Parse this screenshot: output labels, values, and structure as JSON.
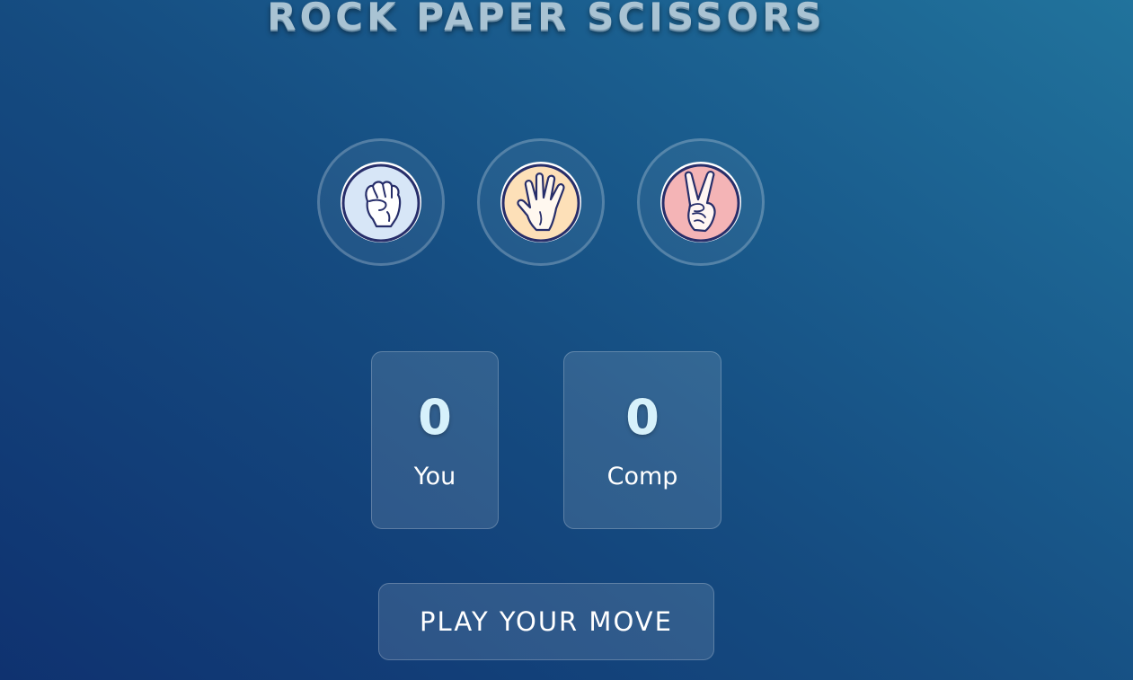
{
  "header": {
    "title": "ROCK PAPER SCISSORS"
  },
  "choices": [
    {
      "name": "rock",
      "icon": "rock-fist-icon",
      "fill": "#d7e6f7"
    },
    {
      "name": "paper",
      "icon": "paper-hand-icon",
      "fill": "#fde0b8"
    },
    {
      "name": "scissors",
      "icon": "scissors-hand-icon",
      "fill": "#f4b4b6"
    }
  ],
  "scoreboard": {
    "user": {
      "score": "0",
      "label": "You"
    },
    "comp": {
      "score": "0",
      "label": "Comp"
    }
  },
  "message": {
    "text": "PLAY YOUR MOVE"
  },
  "colors": {
    "background_start": "#0f3270",
    "background_end": "#21739c",
    "title": "#a9c3d3",
    "score": "#d6f1fb",
    "icon_outline": "#272e6a"
  }
}
